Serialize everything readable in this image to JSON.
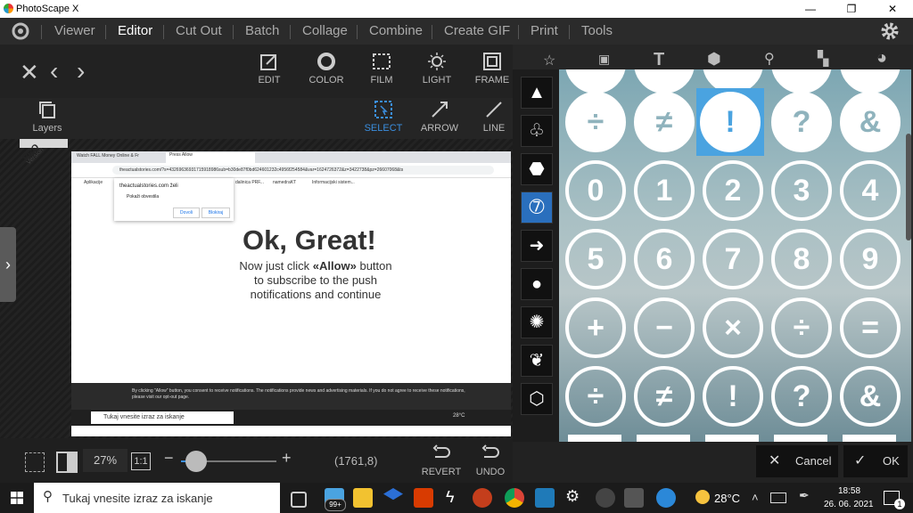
{
  "app": {
    "title": "PhotoScape X"
  },
  "window_controls": {
    "minimize": "—",
    "restore": "❐",
    "close": "✕"
  },
  "menu": [
    "Viewer",
    "Editor",
    "Cut Out",
    "Batch",
    "Collage",
    "Combine",
    "Create GIF",
    "Print",
    "Tools"
  ],
  "active_menu": "Editor",
  "top_tools": [
    "EDIT",
    "COLOR",
    "FILM",
    "LIGHT",
    "FRAME"
  ],
  "sub_tools": [
    "SELECT",
    "ARROW",
    "LINE"
  ],
  "layers_label": "Layers",
  "badge": {
    "line1": "PRO",
    "line2": "Version"
  },
  "photo": {
    "tab1": "Watch FALL Money Online & Fr",
    "tab2": "Press Allow",
    "url": "theactualstories.com/?s=43269636931715918986sub=b30de87f0bd624601232c4956f254584&var=1624726372&z=3422738&pz=26607068&ts",
    "bm1": "Aplikacije",
    "bm2": "dalinica PRF...",
    "bm3": "namedraKT",
    "bm4": "Informacijski sistem...",
    "popup_site": "theactualstories.com želi",
    "popup_item": "Pokaži obvestila",
    "popup_allow": "Dovoli",
    "popup_block": "Blokiraj",
    "headline": "Ok, Great!",
    "body1_pre": "Now just click ",
    "body1_bold": "«Allow»",
    "body1_post": " button",
    "body2": "to subscribe to the push",
    "body3": "notifications and continue",
    "notice": "By clicking \"Allow\" button, you consent to receive notifications. The notifications provide news and advertising materials. If you do not agree to receive these notifications, please visit our opt-out page.",
    "inner_search": "Tukaj vnesite izraz za iskanje",
    "inner_temp": "28°C"
  },
  "zoom": {
    "percent": "27%",
    "one_to_one": "1:1",
    "coords": "(1761,8)"
  },
  "history": [
    "REVERT",
    "UNDO"
  ],
  "icon_rows": [
    [
      "÷",
      "≠",
      "!",
      "?",
      "&"
    ],
    [
      "0",
      "1",
      "2",
      "3",
      "4"
    ],
    [
      "5",
      "6",
      "7",
      "8",
      "9"
    ],
    [
      "+",
      "−",
      "×",
      "÷",
      "="
    ],
    [
      "÷",
      "≠",
      "!",
      "?",
      "&"
    ]
  ],
  "panel_buttons": {
    "cancel": "Cancel",
    "ok": "OK"
  },
  "taskbar": {
    "search": "Tukaj vnesite izraz za iskanje",
    "badge": "99+",
    "temp": "28°C",
    "time": "18:58",
    "date": "26. 06. 2021",
    "notif": "1"
  },
  "colors": {
    "accent": "#3b8fe0",
    "selected_cell": "#4aa3e0"
  }
}
